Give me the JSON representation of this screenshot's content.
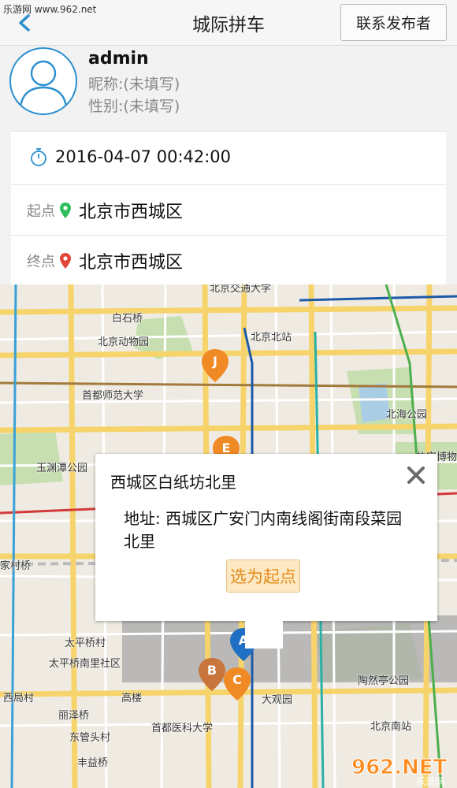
{
  "watermark": {
    "top": "乐游网 www.962.net",
    "logo_text": "962.NET",
    "logo_sub": "乐游网"
  },
  "header": {
    "title": "城际拼车",
    "contact_label": "联系发布者"
  },
  "profile": {
    "username": "admin",
    "nickname": "昵称:(未填写)",
    "gender": "性别:(未填写)"
  },
  "trip": {
    "datetime": "2016-04-07 00:42:00",
    "start_label": "起点",
    "start_place": "北京市西城区",
    "end_label": "终点",
    "end_place": "北京市西城区",
    "start_pin_color": "#2fbe5c",
    "end_pin_color": "#e0473a"
  },
  "map": {
    "labels": {
      "jiaotong": "北京交通大学",
      "baishiqiao": "白石桥",
      "zoo": "北京动物园",
      "beijingbei": "北京北站",
      "shifan": "首都师范大学",
      "beihai": "北海公园",
      "yuyuantan": "玉渊潭公园",
      "gugong": "故宫博物",
      "jiajia": "家村桥",
      "taiping": "太平桥村",
      "taipingnan": "太平桥南里社区",
      "xiju": "西局村",
      "gaolou": "高楼",
      "daguanyuan": "大观园",
      "taoranting": "陶然亭公园",
      "lize": "丽泽桥",
      "dongguan": "东管头村",
      "yike": "首都医科大学",
      "beijingnan": "北京南站",
      "fengyi": "丰益桥"
    },
    "markers": [
      "J",
      "E",
      "A",
      "B",
      "C"
    ],
    "marker_color": "#f08a24",
    "selected_marker_color": "#1f6fc4"
  },
  "popup": {
    "title": "西城区白纸坊北里",
    "address": "地址: 西城区广安门内南线阁街南段菜园北里",
    "action_label": "选为起点"
  }
}
